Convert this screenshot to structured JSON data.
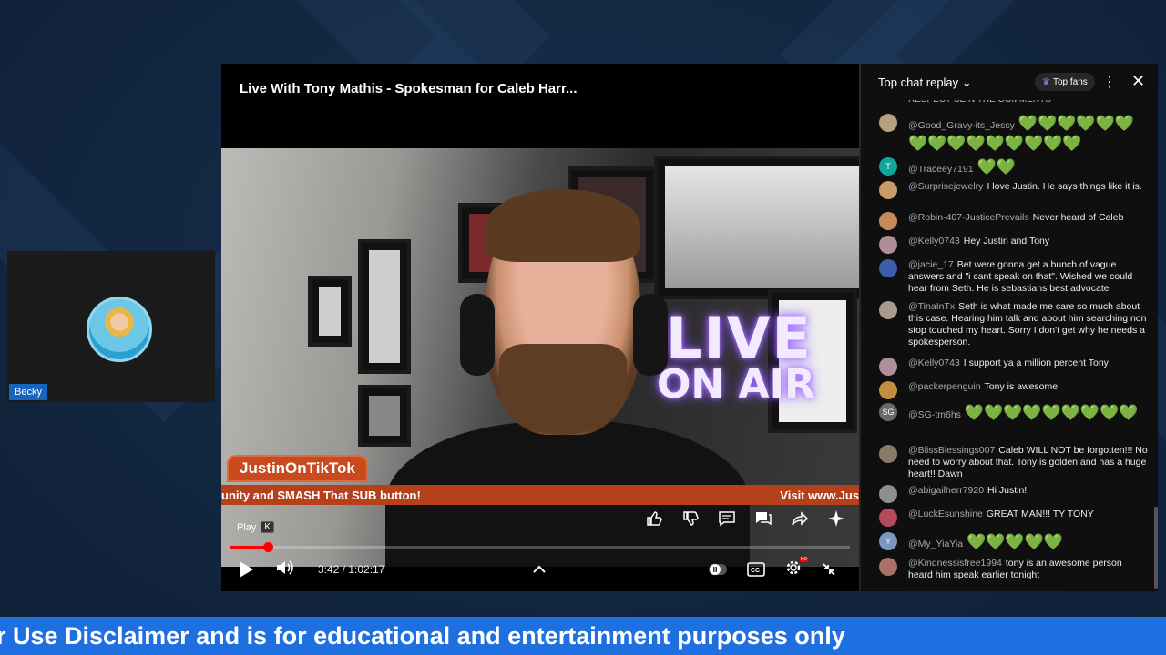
{
  "guest": {
    "name": "Becky"
  },
  "player": {
    "title": "Live With Tony Mathis - Spokesman for Caleb Harr...",
    "neon_line1": "LIVE",
    "neon_line2": "ON AIR",
    "lower_third_name": "JustinOnTikTok",
    "ticker_left": "unity and SMASH That SUB button!",
    "ticker_right": "Visit www.Jus",
    "tooltip_label": "Play",
    "tooltip_key": "K",
    "time_display": "3:42 / 1:02:17",
    "progress_fraction": 0.06,
    "settings_badge": "HD",
    "actions": [
      "like-icon",
      "dislike-icon",
      "comment-icon",
      "chat-icon",
      "share-icon",
      "sparkle-icon"
    ]
  },
  "chat": {
    "header_title": "Top chat replay",
    "top_fans_label": "Top fans",
    "cut_message": "RESPECT SEIN THE COMMENTS",
    "messages": [
      {
        "user": "@Good_Gravy-its_Jessy",
        "text": "💚💚💚💚💚💚💚💚💚💚💚💚💚💚💚",
        "avatar_color": "#b7a07c",
        "avatar_letter": ""
      },
      {
        "user": "@Traceey7191",
        "text": "💚💚",
        "avatar_color": "#12a5a0",
        "avatar_letter": "T"
      },
      {
        "user": "@Surprisejewelry",
        "text": "I love Justin. He says things like it is.",
        "avatar_color": "#c79b6a",
        "avatar_letter": ""
      },
      {
        "user": "@Robin-407-JusticePrevails",
        "text": "Never heard of Caleb",
        "avatar_color": "#c78a5d",
        "avatar_letter": ""
      },
      {
        "user": "@Kelly0743",
        "text": "Hey Justin and Tony",
        "avatar_color": "#b08d9a",
        "avatar_letter": ""
      },
      {
        "user": "@jacie_17",
        "text": "Bet were gonna get a bunch of vague answers and \"i cant speak on that\". Wished we could hear from Seth. He is sebastians best advocate",
        "avatar_color": "#3c5da8",
        "avatar_letter": ""
      },
      {
        "user": "@TinaInTx",
        "text": "Seth is what made me care so much about this case. Hearing him talk and about him searching non stop touched my heart. Sorry I don't get why he needs a spokesperson.",
        "avatar_color": "#a89b8c",
        "avatar_letter": ""
      },
      {
        "user": "@Kelly0743",
        "text": "I support ya a million percent Tony",
        "avatar_color": "#b08d9a",
        "avatar_letter": ""
      },
      {
        "user": "@packerpenguin",
        "text": "Tony is awesome",
        "avatar_color": "#c28d40",
        "avatar_letter": ""
      },
      {
        "user": "@SG-tm6hs",
        "text": "💚💚💚💚💚💚💚💚💚",
        "avatar_color": "#6a6a6a",
        "avatar_letter": "SG"
      },
      {
        "user": "@BlissBlessings007",
        "text": "Caleb WILL NOT be forgotten!!! No need to worry about that. Tony is golden and has a huge heart!! Dawn",
        "avatar_color": "#8a7a6a",
        "avatar_letter": ""
      },
      {
        "user": "@abigailherr7920",
        "text": "Hi Justin!",
        "avatar_color": "#8e8e8e",
        "avatar_letter": ""
      },
      {
        "user": "@LuckEsunshine",
        "text": "GREAT MAN!!! TY TONY",
        "avatar_color": "#b44a5a",
        "avatar_letter": ""
      },
      {
        "user": "@My_YiaYia",
        "text": "💚💚💚💚💚",
        "avatar_color": "#7e97c2",
        "avatar_letter": "Y"
      },
      {
        "user": "@Kindnessisfree1994",
        "text": "tony is an awesome person heard him speak earlier tonight",
        "avatar_color": "#a8726a",
        "avatar_letter": ""
      }
    ]
  },
  "banner": {
    "text": "r Use Disclaimer and is for educational and entertainment purposes only"
  },
  "colors": {
    "banner": "#1e6fe0",
    "progress": "#ff0000",
    "heart": "#57c235",
    "ticker": "#b5401c"
  }
}
